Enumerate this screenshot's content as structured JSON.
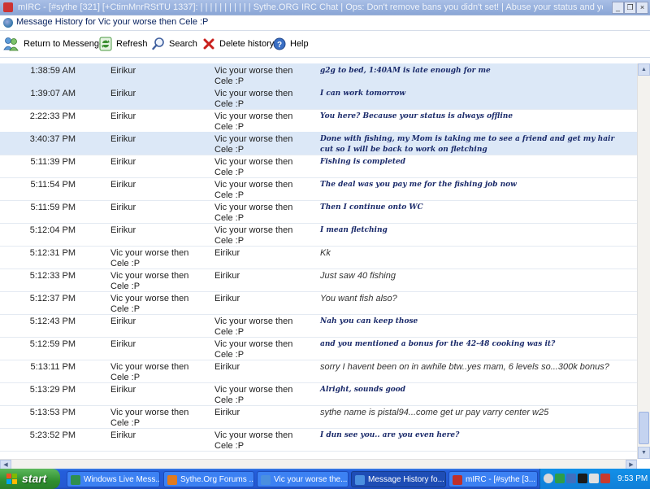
{
  "background_window": {
    "title": "mIRC - [#sythe [321] [+CtimMnrRStTU 1337]: | | | | | | | | | | | Sythe.ORG IRC Chat | Ops: Don't remove bans you didn't set! | Abuse your status and yo..."
  },
  "window": {
    "title": "Message History for Vic your worse then Cele :P"
  },
  "toolbar": {
    "return_label": "Return to Messenger",
    "refresh_label": "Refresh",
    "search_label": "Search",
    "delete_label": "Delete history",
    "help_label": "Help"
  },
  "messages": [
    {
      "time": "1:38:59 AM",
      "from": "Eirikur",
      "to": "Vic your worse then Cele :P",
      "text": "g2g to bed, 1:40AM is late enough for me",
      "style": "fancy",
      "selected": true
    },
    {
      "time": "1:39:07 AM",
      "from": "Eirikur",
      "to": "Vic your worse then Cele :P",
      "text": "I can work tomorrow",
      "style": "fancy",
      "selected": true
    },
    {
      "time": "2:22:33 PM",
      "from": "Eirikur",
      "to": "Vic your worse then Cele :P",
      "text": "You here? Because your status is always offline",
      "style": "fancy",
      "selected": false
    },
    {
      "time": "3:40:37 PM",
      "from": "Eirikur",
      "to": "Vic your worse then Cele :P",
      "text": "Done with fishing, my Mom is taking me to see a friend and get my hair cut so I will be back to work on fletching",
      "style": "fancy",
      "selected": true
    },
    {
      "time": "5:11:39 PM",
      "from": "Eirikur",
      "to": "Vic your worse then Cele :P",
      "text": "Fishing is completed",
      "style": "fancy",
      "selected": false
    },
    {
      "time": "5:11:54 PM",
      "from": "Eirikur",
      "to": "Vic your worse then Cele :P",
      "text": "The deal was you pay me for the fishing job now",
      "style": "fancy",
      "selected": false
    },
    {
      "time": "5:11:59 PM",
      "from": "Eirikur",
      "to": "Vic your worse then Cele :P",
      "text": "Then I continue onto WC",
      "style": "fancy",
      "selected": false
    },
    {
      "time": "5:12:04 PM",
      "from": "Eirikur",
      "to": "Vic your worse then Cele :P",
      "text": "I mean fletching",
      "style": "fancy",
      "selected": false
    },
    {
      "time": "5:12:31 PM",
      "from": "Vic your worse then Cele :P",
      "to": "Eirikur",
      "text": "Kk",
      "style": "plain",
      "selected": false
    },
    {
      "time": "5:12:33 PM",
      "from": "Vic your worse then Cele :P",
      "to": "Eirikur",
      "text": "Just saw 40 fishing",
      "style": "plain",
      "selected": false
    },
    {
      "time": "5:12:37 PM",
      "from": "Vic your worse then Cele :P",
      "to": "Eirikur",
      "text": "You want fish also?",
      "style": "plain",
      "selected": false
    },
    {
      "time": "5:12:43 PM",
      "from": "Eirikur",
      "to": "Vic your worse then Cele :P",
      "text": "Nah you can keep those",
      "style": "fancy",
      "selected": false
    },
    {
      "time": "5:12:59 PM",
      "from": "Eirikur",
      "to": "Vic your worse then Cele :P",
      "text": "and you mentioned a bonus for the 42-48 cooking was it?",
      "style": "fancy",
      "selected": false
    },
    {
      "time": "5:13:11 PM",
      "from": "Vic your worse then Cele :P",
      "to": "Eirikur",
      "text": "sorry I havent been on in awhile btw..yes mam, 6 levels so...300k bonus?",
      "style": "plain",
      "selected": false
    },
    {
      "time": "5:13:29 PM",
      "from": "Eirikur",
      "to": "Vic your worse then Cele :P",
      "text": "Alright, sounds good",
      "style": "fancy",
      "selected": false
    },
    {
      "time": "5:13:53 PM",
      "from": "Vic your worse then Cele :P",
      "to": "Eirikur",
      "text": "sythe name is pistal94...come get ur pay varry center w25",
      "style": "plain",
      "selected": false
    },
    {
      "time": "5:23:52 PM",
      "from": "Eirikur",
      "to": "Vic your worse then Cele :P",
      "text": "I dun see you.. are you even here?",
      "style": "fancy",
      "selected": false
    }
  ],
  "taskbar": {
    "start_label": "start",
    "tasks": [
      {
        "label": "Windows Live Mess...",
        "color": "#2f8f4f"
      },
      {
        "label": "Sythe.Org Forums ...",
        "color": "#e07a1f"
      },
      {
        "label": "Vic your worse the...",
        "color": "#4a8fe0"
      },
      {
        "label": "Message History fo...",
        "color": "#4a8fe0",
        "active": true
      },
      {
        "label": "mIRC - [#sythe [3...",
        "color": "#c0302a"
      }
    ],
    "clock": "9:53 PM"
  }
}
